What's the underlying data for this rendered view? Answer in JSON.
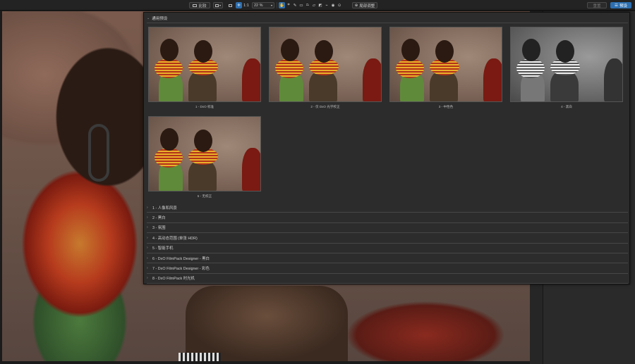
{
  "toolbar": {
    "compare_label": "比较",
    "zoom_fit_label": "1:1",
    "zoom_level": "22 %",
    "adjust_label": "局部调整",
    "right_btn1_label": "重置",
    "right_btn2_label": "预设"
  },
  "presets": {
    "section_title": "通用预设",
    "thumbnails": [
      {
        "caption": "1 - DxO 标准",
        "tone": "color"
      },
      {
        "caption": "2 - 仅 DxO 光学校正",
        "tone": "color"
      },
      {
        "caption": "3 - 中性色",
        "tone": "color"
      },
      {
        "caption": "4 - 黑白",
        "tone": "bw"
      },
      {
        "caption": "5 - 无校正",
        "tone": "color"
      }
    ],
    "categories": [
      "1 - 人像和风景",
      "2 - 黑白",
      "3 - 氛围",
      "4 - 高动态范围 (单张 HDR)",
      "5 - 智能手机",
      "6 - DxO FilmPack Designer - 黑白",
      "7 - DxO FilmPack Designer - 彩色",
      "8 - DxO FilmPack 时光机"
    ]
  },
  "colors": {
    "accent": "#2d6fb0",
    "panel_bg": "#2c2c2c"
  }
}
